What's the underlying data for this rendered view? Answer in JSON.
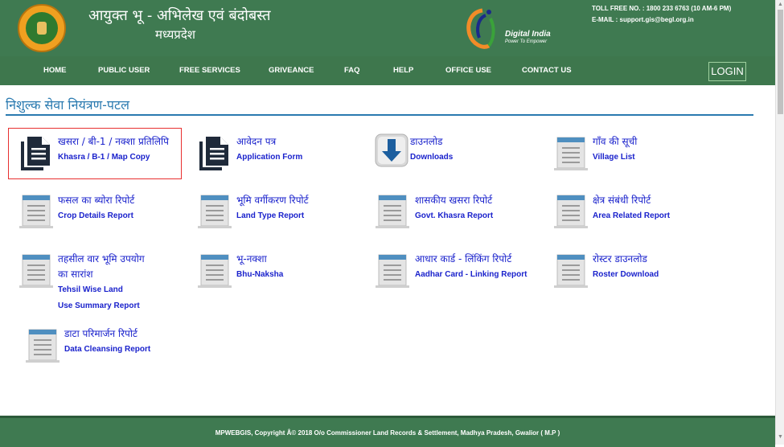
{
  "header": {
    "title_line1": "आयुक्त  भू - अभिलेख एवं बंदोबस्त",
    "title_line2": "मध्यप्रदेश",
    "digital_india": "Digital India",
    "digital_india_tagline": "Power To Empower",
    "toll_free": "TOLL FREE NO. : 1800 233 6763 (10 AM-6 PM)",
    "email": "E-MAIL : support.gis@begl.org.in"
  },
  "nav": {
    "items": [
      "HOME",
      "PUBLIC USER",
      "FREE SERVICES",
      "GRIVEANCE",
      "FAQ",
      "HELP",
      "OFFICE USE",
      "CONTACT US"
    ],
    "login_label": "LOGIN"
  },
  "page": {
    "title": "निशुल्क सेवा नियंत्रण-पटल"
  },
  "services": [
    {
      "hi": "खसरा / बी-1 / नक्शा प्रतिलिपि",
      "en": "Khasra / B-1 / Map Copy",
      "icon": "document-copy-icon"
    },
    {
      "hi": "आवेदन पत्र",
      "en": "Application Form",
      "icon": "document-copy-icon"
    },
    {
      "hi": "डाउनलोड",
      "en": "Downloads",
      "icon": "download-icon"
    },
    {
      "hi": "गाँव की सूची",
      "en": "Village List",
      "icon": "report-icon"
    },
    {
      "hi": "फसल का ब्योरा रिपोर्ट",
      "en": "Crop Details Report",
      "icon": "report-icon"
    },
    {
      "hi": "भूमि वर्गीकरण रिपोर्ट",
      "en": "Land Type Report",
      "icon": "report-icon"
    },
    {
      "hi": "शासकीय खसरा रिपोर्ट",
      "en": "Govt. Khasra Report",
      "icon": "report-icon"
    },
    {
      "hi": "क्षेत्र संबंधी रिपोर्ट",
      "en": "Area Related Report",
      "icon": "report-icon"
    },
    {
      "hi": "तहसील वार भूमि उपयोग",
      "hi2": "का सारांश",
      "en": "Tehsil Wise Land",
      "en2": "Use Summary Report",
      "icon": "report-icon"
    },
    {
      "hi": "भू-नक्शा",
      "en": "Bhu-Naksha",
      "icon": "report-icon"
    },
    {
      "hi": "आधार कार्ड - लिंकिंग रिपोर्ट",
      "en": "Aadhar Card - Linking Report",
      "icon": "report-icon"
    },
    {
      "hi": "रोस्टर डाउनलोड",
      "en": "Roster Download",
      "icon": "report-icon"
    },
    {
      "hi": "डाटा परिमार्जन रिपोर्ट",
      "en": "Data Cleansing Report",
      "icon": "report-icon"
    }
  ],
  "footer": {
    "text": "MPWEBGIS, Copyright Â© 2018 O/o Commissioner Land Records & Settlement, Madhya Pradesh, Gwalior ( M.P )"
  },
  "colors": {
    "header_green": "#3f7a51",
    "link_blue": "#1a22cc",
    "title_blue": "#2a7ab0",
    "highlight_red": "#e83030"
  }
}
